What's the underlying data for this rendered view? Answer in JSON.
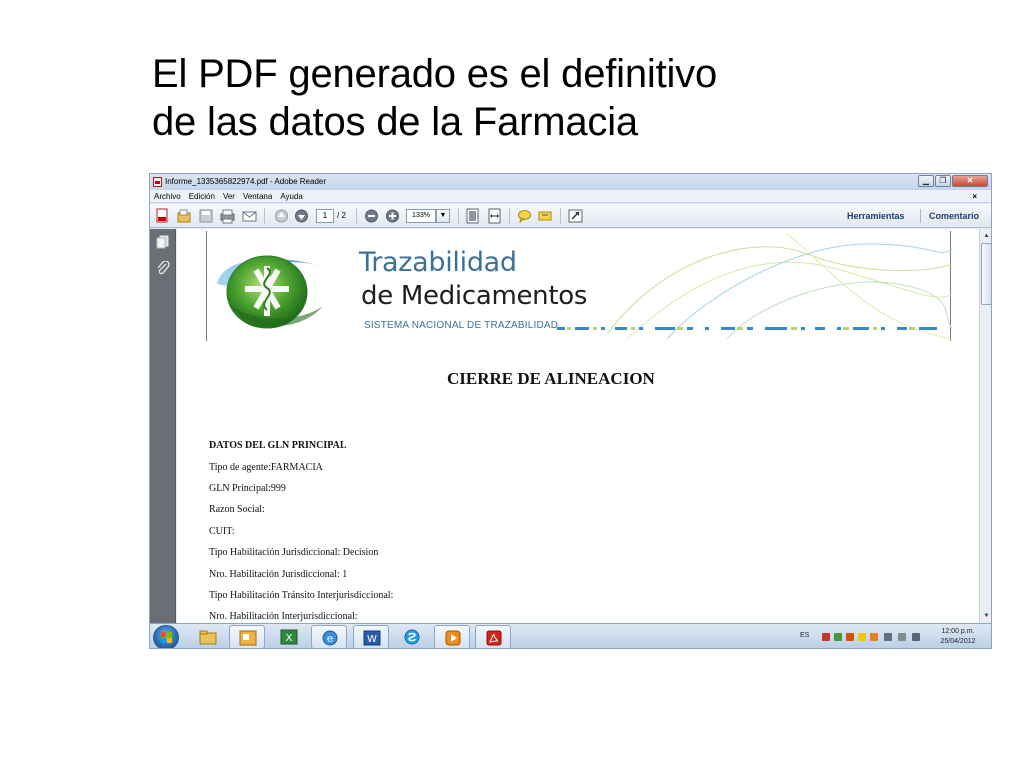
{
  "slide": {
    "title_line1": "El PDF generado es el definitivo",
    "title_line2": "de las datos de la Farmacia"
  },
  "window": {
    "title": "Informe_1335365822974.pdf - Adobe Reader",
    "menu": [
      "Archivo",
      "Edición",
      "Ver",
      "Ventana",
      "Ayuda"
    ],
    "doc_close_glyph": "×"
  },
  "toolbar": {
    "page_current": "1",
    "page_total": "/ 2",
    "zoom": "133%",
    "zoom_dropdown_glyph": "▼",
    "tools_label": "Herramientas",
    "comment_label": "Comentario"
  },
  "document": {
    "brand_line1": "Trazabilidad",
    "brand_line2": "de Medicamentos",
    "brand_line3": "SISTEMA NACIONAL DE TRAZABILIDAD",
    "heading": "CIERRE DE ALINEACION",
    "section_heading": "DATOS DEL GLN PRINCIPAL",
    "fields": [
      "Tipo de agente:FARMACIA",
      "GLN Principal:999",
      "Razon Social:",
      "CUIT:",
      "Tipo Habilitación Jurisdiccional: Decision",
      "Nro. Habilitación Jurisdiccional: 1",
      "Tipo Habilitación Tránsito Interjurisdiccional:",
      "Nro. Habilitación Interjurisdiccional:"
    ]
  },
  "taskbar": {
    "language": "ES",
    "time": "12:00 p.m.",
    "date": "25/04/2012"
  },
  "colors": {
    "brand_blue": "#3a7198",
    "logo_green": "#4aa22e"
  }
}
